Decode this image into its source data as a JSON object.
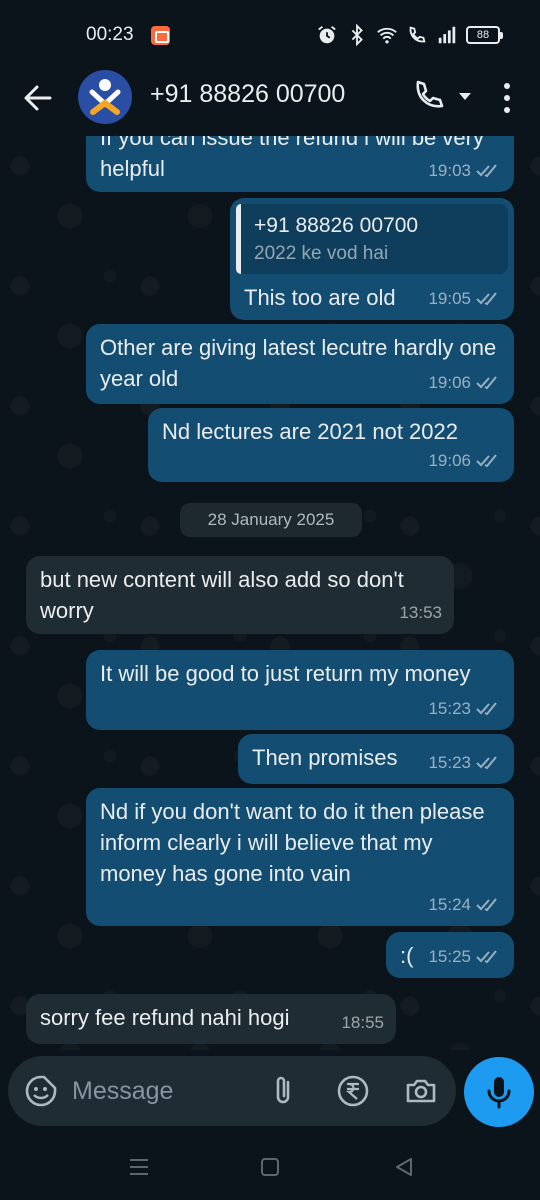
{
  "status_bar": {
    "time": "00:23",
    "battery": "88"
  },
  "header": {
    "title": "+91 88826 00700"
  },
  "messages": [
    {
      "side": "out",
      "text": "If you can issue the refund i will be very helpful",
      "time": "19:03",
      "status": "read"
    },
    {
      "side": "out",
      "reply_to_name": "+91 88826 00700",
      "reply_to_text": "2022 ke vod hai",
      "text": "This too are old",
      "time": "19:05",
      "status": "read"
    },
    {
      "side": "out",
      "text": "Other are giving latest lecutre hardly one year old",
      "time": "19:06",
      "status": "read"
    },
    {
      "side": "out",
      "text": "Nd lectures are 2021 not 2022",
      "time": "19:06",
      "status": "read"
    },
    {
      "side": "in",
      "text": "but new content will also add so don't worry",
      "time": "13:53"
    },
    {
      "side": "out",
      "text": "It will be good to just return my money",
      "time": "15:23",
      "status": "read"
    },
    {
      "side": "out",
      "text": "Then promises",
      "time": "15:23",
      "status": "read"
    },
    {
      "side": "out",
      "text": "Nd if you don't want to do it then please inform clearly i will believe that my money has gone into vain",
      "time": "15:24",
      "status": "read"
    },
    {
      "side": "out",
      "text": ":(",
      "time": "15:25",
      "status": "read"
    },
    {
      "side": "in",
      "text": "sorry fee refund nahi hogi",
      "time": "18:55"
    }
  ],
  "date_divider": "28 January 2025",
  "composer": {
    "placeholder": "Message"
  },
  "colors": {
    "outgoing": "#144d72",
    "incoming": "#202c33",
    "accent": "#1d9bf0",
    "background": "#0b141a"
  },
  "icons": [
    "back-arrow-icon",
    "avatar-logo",
    "phone-icon",
    "chevron-down-icon",
    "more-vert-icon",
    "emoji-icon",
    "paperclip-icon",
    "rupee-icon",
    "camera-icon",
    "mic-icon",
    "double-check-icon",
    "alarm-icon",
    "bluetooth-icon",
    "wifi-icon",
    "volte-call-icon",
    "signal-icon",
    "battery-icon",
    "nav-menu-icon",
    "nav-home-icon",
    "nav-back-icon"
  ]
}
